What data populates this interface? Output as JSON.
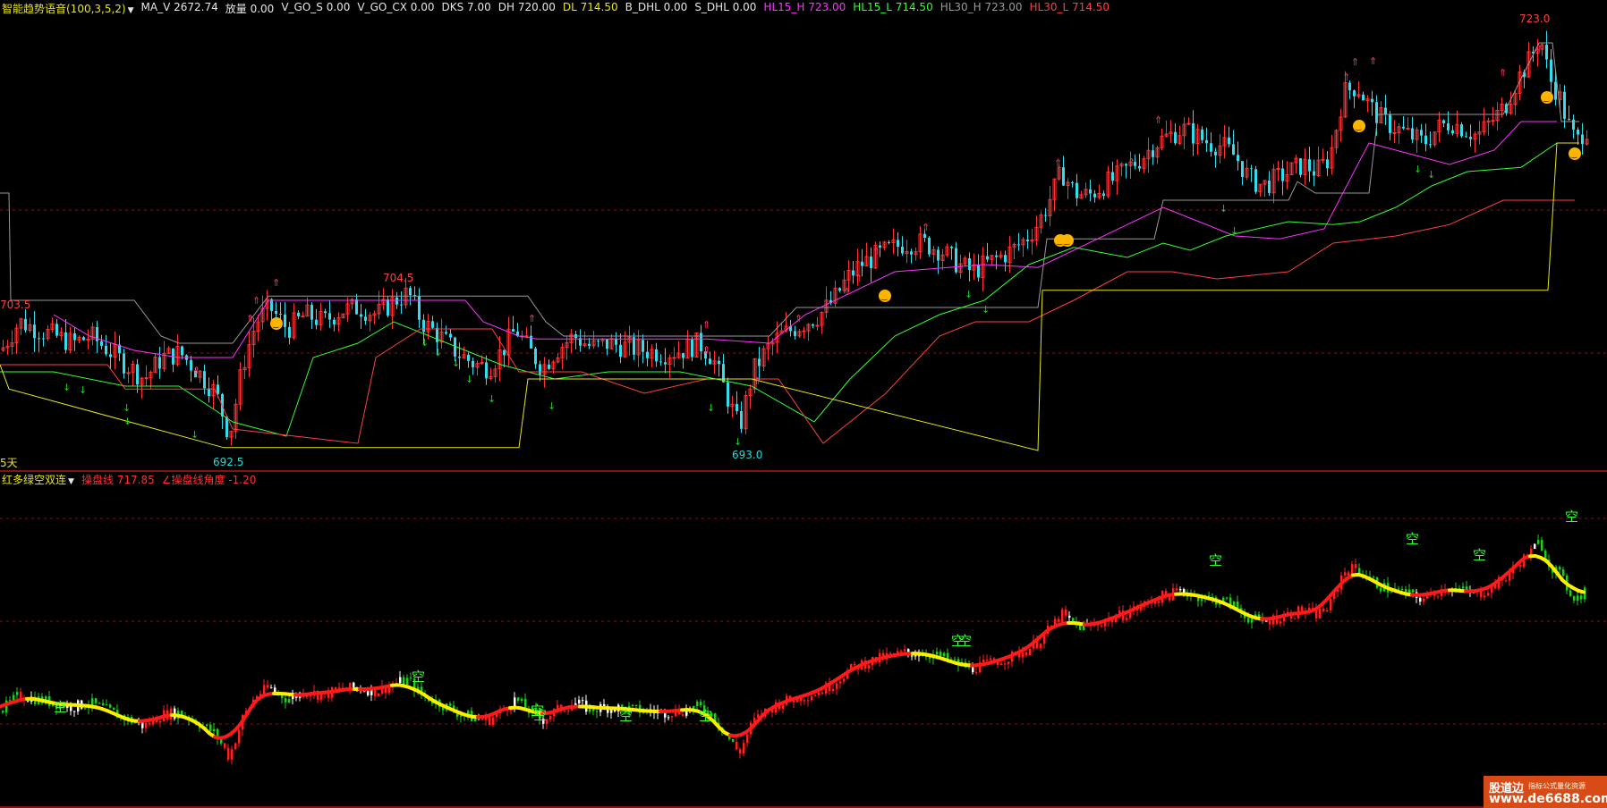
{
  "main_legend": {
    "title": "智能趋势语音(100,3,5,2)",
    "items": [
      {
        "label": "MA_V 2672.74",
        "color": "#e6e6e6"
      },
      {
        "label": "放量 0.00",
        "color": "#e6e6e6"
      },
      {
        "label": "V_GO_S 0.00",
        "color": "#e6e6e6"
      },
      {
        "label": "V_GO_CX 0.00",
        "color": "#e6e6e6"
      },
      {
        "label": "DKS 7.00",
        "color": "#e6e6e6"
      },
      {
        "label": "DH 720.00",
        "color": "#e6e6e6"
      },
      {
        "label": "DL 714.50",
        "color": "#e6e61a"
      },
      {
        "label": "B_DHL 0.00",
        "color": "#e6e6e6"
      },
      {
        "label": "S_DHL 0.00",
        "color": "#e6e6e6"
      },
      {
        "label": "HL15_H 723.00",
        "color": "#ff33ff"
      },
      {
        "label": "HL15_L 714.50",
        "color": "#33ff33"
      },
      {
        "label": "HL30_H 723.00",
        "color": "#9a9a9a"
      },
      {
        "label": "HL30_L 714.50",
        "color": "#ff4040"
      }
    ]
  },
  "sub_legend": {
    "title": "红多绿空双连",
    "items": [
      {
        "label": "操盘线 717.85",
        "color": "#ff3030"
      },
      {
        "label": "∠操盘线角度 -1.20",
        "color": "#ff3030"
      }
    ]
  },
  "chart_data": {
    "type": "candlestick",
    "price_labels": [
      {
        "text": "703.5"
      },
      {
        "text": "704.5"
      },
      {
        "text": "692.5"
      },
      {
        "text": "693.0"
      },
      {
        "text": "723.0"
      }
    ],
    "day_label": "5天",
    "signal_char": "空",
    "signal_char_count": 12,
    "approx_price_range": [
      692.5,
      723.0
    ],
    "colors": {
      "up": "#ff3333",
      "down": "#33ddee",
      "sub_up": "#ff2020",
      "sub_down": "#22cc22",
      "sub_neutral": "#ffffff",
      "line_red": "#ff1a1a",
      "line_yellow": "#ffee00"
    }
  },
  "watermark": {
    "brand": "股道边",
    "tagline": "指标公式量化资源",
    "url": "www.de6688.com"
  }
}
